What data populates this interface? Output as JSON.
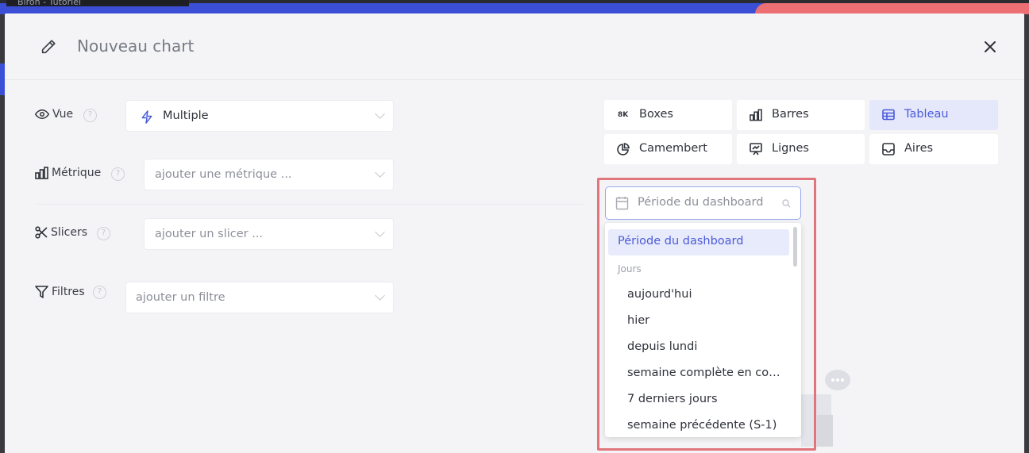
{
  "background": {
    "tab_label": "Biron - Tutoriel"
  },
  "modal": {
    "title": "Nouveau chart",
    "icons": {
      "edit": "pencil-icon",
      "close": "close-icon"
    }
  },
  "form": {
    "vue": {
      "label": "Vue",
      "value": "Multiple",
      "icon": "eye-icon",
      "value_icon": "bolt-icon"
    },
    "metrique": {
      "label": "Métrique",
      "placeholder": "ajouter une métrique ...",
      "icon": "bar-chart-icon"
    },
    "slicers": {
      "label": "Slicers",
      "placeholder": "ajouter un slicer ...",
      "icon": "scissors-icon"
    },
    "filtres": {
      "label": "Filtres",
      "placeholder": "ajouter un filtre",
      "icon": "filter-icon"
    },
    "help_glyph": "?"
  },
  "chart_types": [
    {
      "label": "Boxes",
      "icon": "boxes-icon",
      "glyph": "8K",
      "active": false
    },
    {
      "label": "Barres",
      "icon": "bar-chart-icon",
      "active": false
    },
    {
      "label": "Tableau",
      "icon": "table-icon",
      "active": true
    },
    {
      "label": "Camembert",
      "icon": "pie-chart-icon",
      "active": false
    },
    {
      "label": "Lignes",
      "icon": "line-chart-icon",
      "active": false
    },
    {
      "label": "Aires",
      "icon": "area-chart-icon",
      "active": false
    }
  ],
  "period": {
    "placeholder": "Période du dashboard",
    "selected": "Période du dashboard",
    "group_label": "Jours",
    "options": [
      "aujourd'hui",
      "hier",
      "depuis lundi",
      "semaine complète en cours",
      "7 derniers jours",
      "semaine précédente (S-1)"
    ]
  },
  "colors": {
    "accent": "#4a5bd9",
    "highlight": "#e0757b",
    "active_bg": "#e5e8fb"
  }
}
